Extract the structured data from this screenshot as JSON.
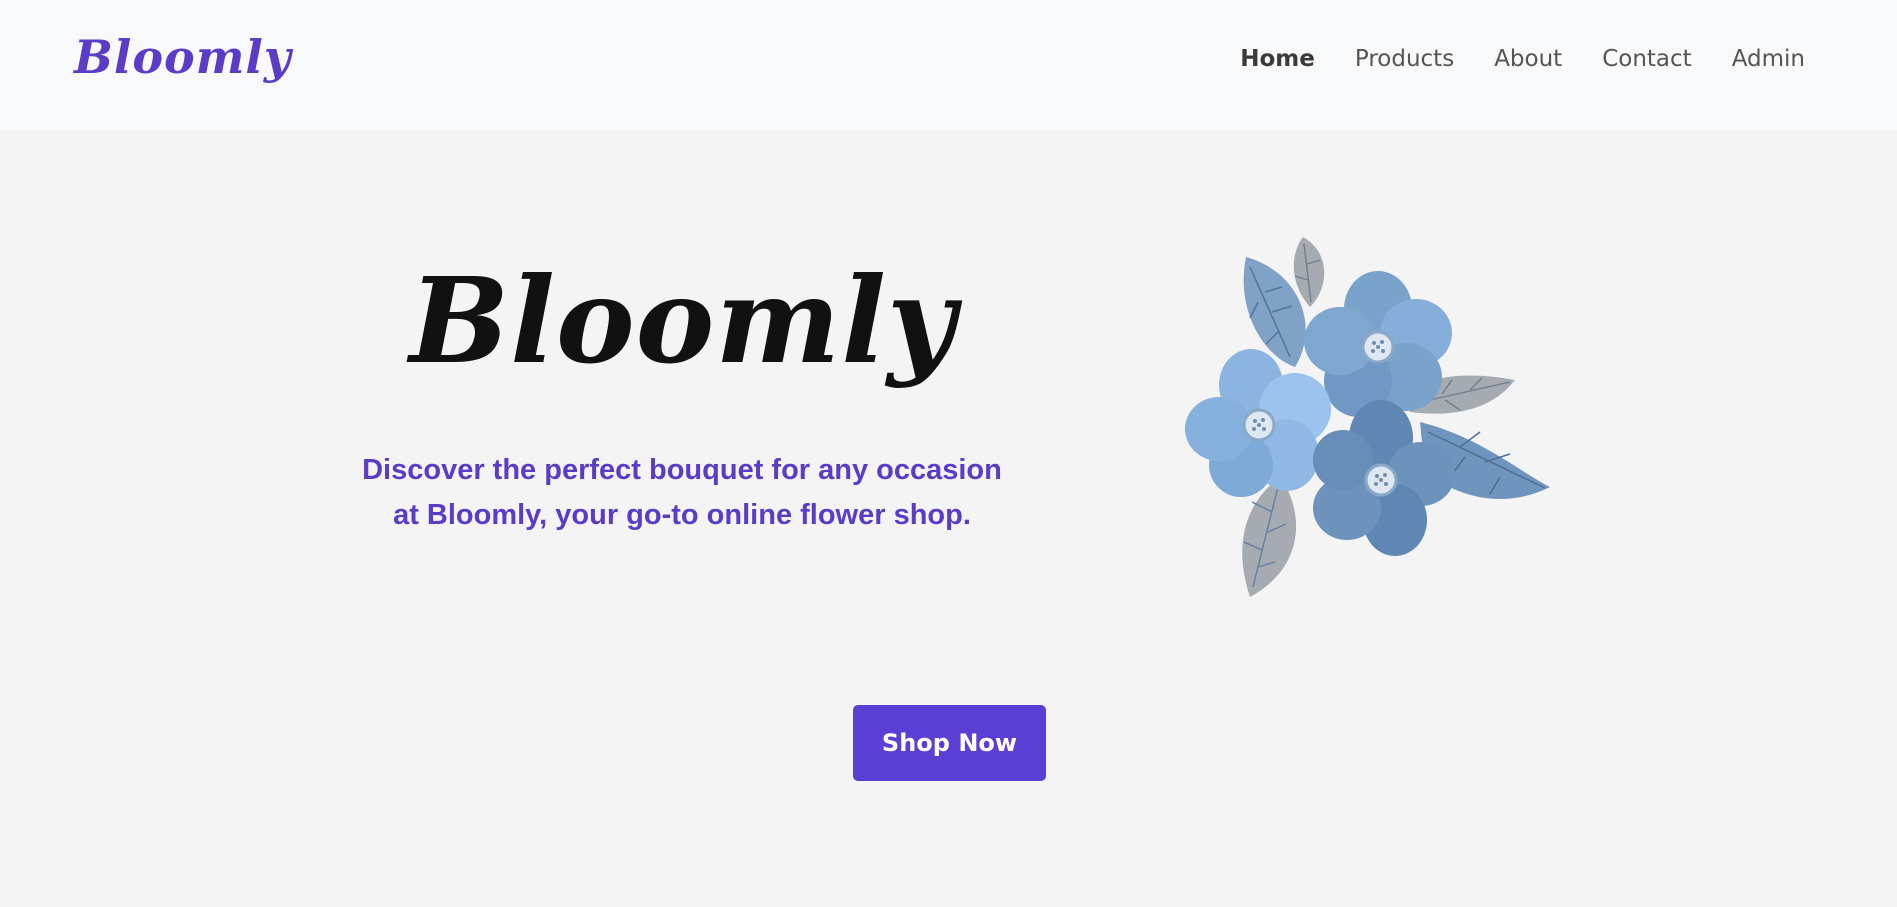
{
  "header": {
    "logo": "Bloomly",
    "nav": [
      {
        "label": "Home",
        "active": true
      },
      {
        "label": "Products",
        "active": false
      },
      {
        "label": "About",
        "active": false
      },
      {
        "label": "Contact",
        "active": false
      },
      {
        "label": "Admin",
        "active": false
      }
    ]
  },
  "hero": {
    "title": "Bloomly",
    "subtitle_line1": "Discover the perfect bouquet for any occasion",
    "subtitle_line2": "at Bloomly, your go-to online flower shop.",
    "cta_label": "Shop Now",
    "illustration": "blue-flower-bouquet-icon"
  },
  "colors": {
    "brand": "#5a3cc6",
    "button": "#5b3fd4",
    "navbar_bg": "#f8f9fa",
    "page_bg": "#f4f4f4",
    "title": "#111111",
    "nav_text": "#555555"
  }
}
